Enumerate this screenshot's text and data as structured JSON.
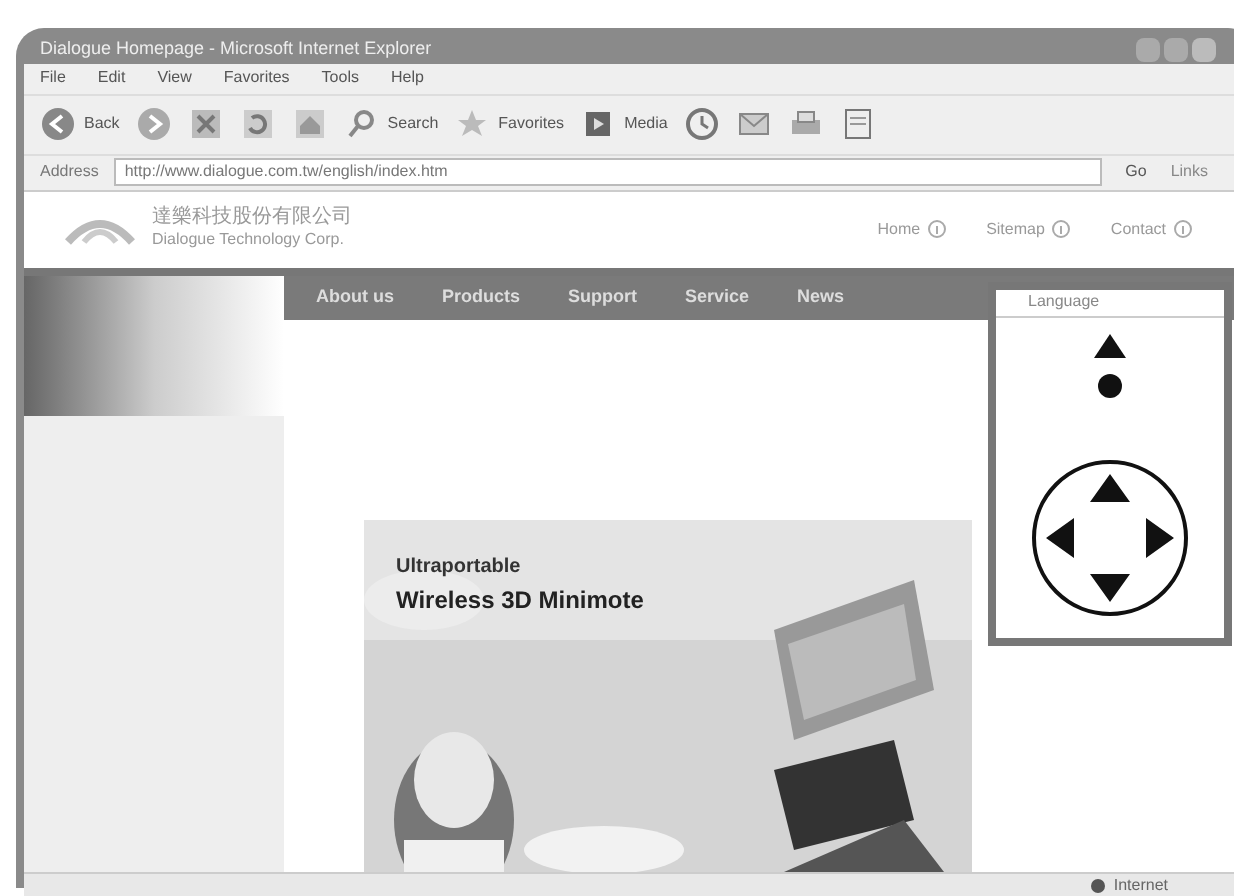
{
  "window": {
    "title": "Dialogue Homepage - Microsoft Internet Explorer"
  },
  "menu": [
    "File",
    "Edit",
    "View",
    "Favorites",
    "Tools",
    "Help"
  ],
  "toolbar": [
    {
      "kind": "back",
      "label": "Back"
    },
    {
      "kind": "forward"
    },
    {
      "kind": "stop"
    },
    {
      "kind": "refresh"
    },
    {
      "kind": "home"
    },
    {
      "kind": "search",
      "label": "Search"
    },
    {
      "kind": "favorites",
      "label": "Favorites"
    },
    {
      "kind": "media",
      "label": "Media"
    },
    {
      "kind": "history"
    },
    {
      "kind": "mail"
    },
    {
      "kind": "print"
    },
    {
      "kind": "edit"
    }
  ],
  "address": {
    "label": "Address",
    "value": "http://www.dialogue.com.tw/english/index.htm",
    "go": "Go",
    "links": "Links"
  },
  "site": {
    "company_cn": "達樂科技股份有限公司",
    "company_en": "Dialogue Technology Corp.",
    "header_links": [
      "Home",
      "Sitemap",
      "Contact"
    ],
    "nav": [
      "About us",
      "Products",
      "Support",
      "Service",
      "News"
    ],
    "banner": {
      "line1": "Ultraportable",
      "line2": "Wireless 3D Minimote"
    }
  },
  "overlay": {
    "language": "Language"
  },
  "status_bar": {
    "zone": "Internet"
  }
}
